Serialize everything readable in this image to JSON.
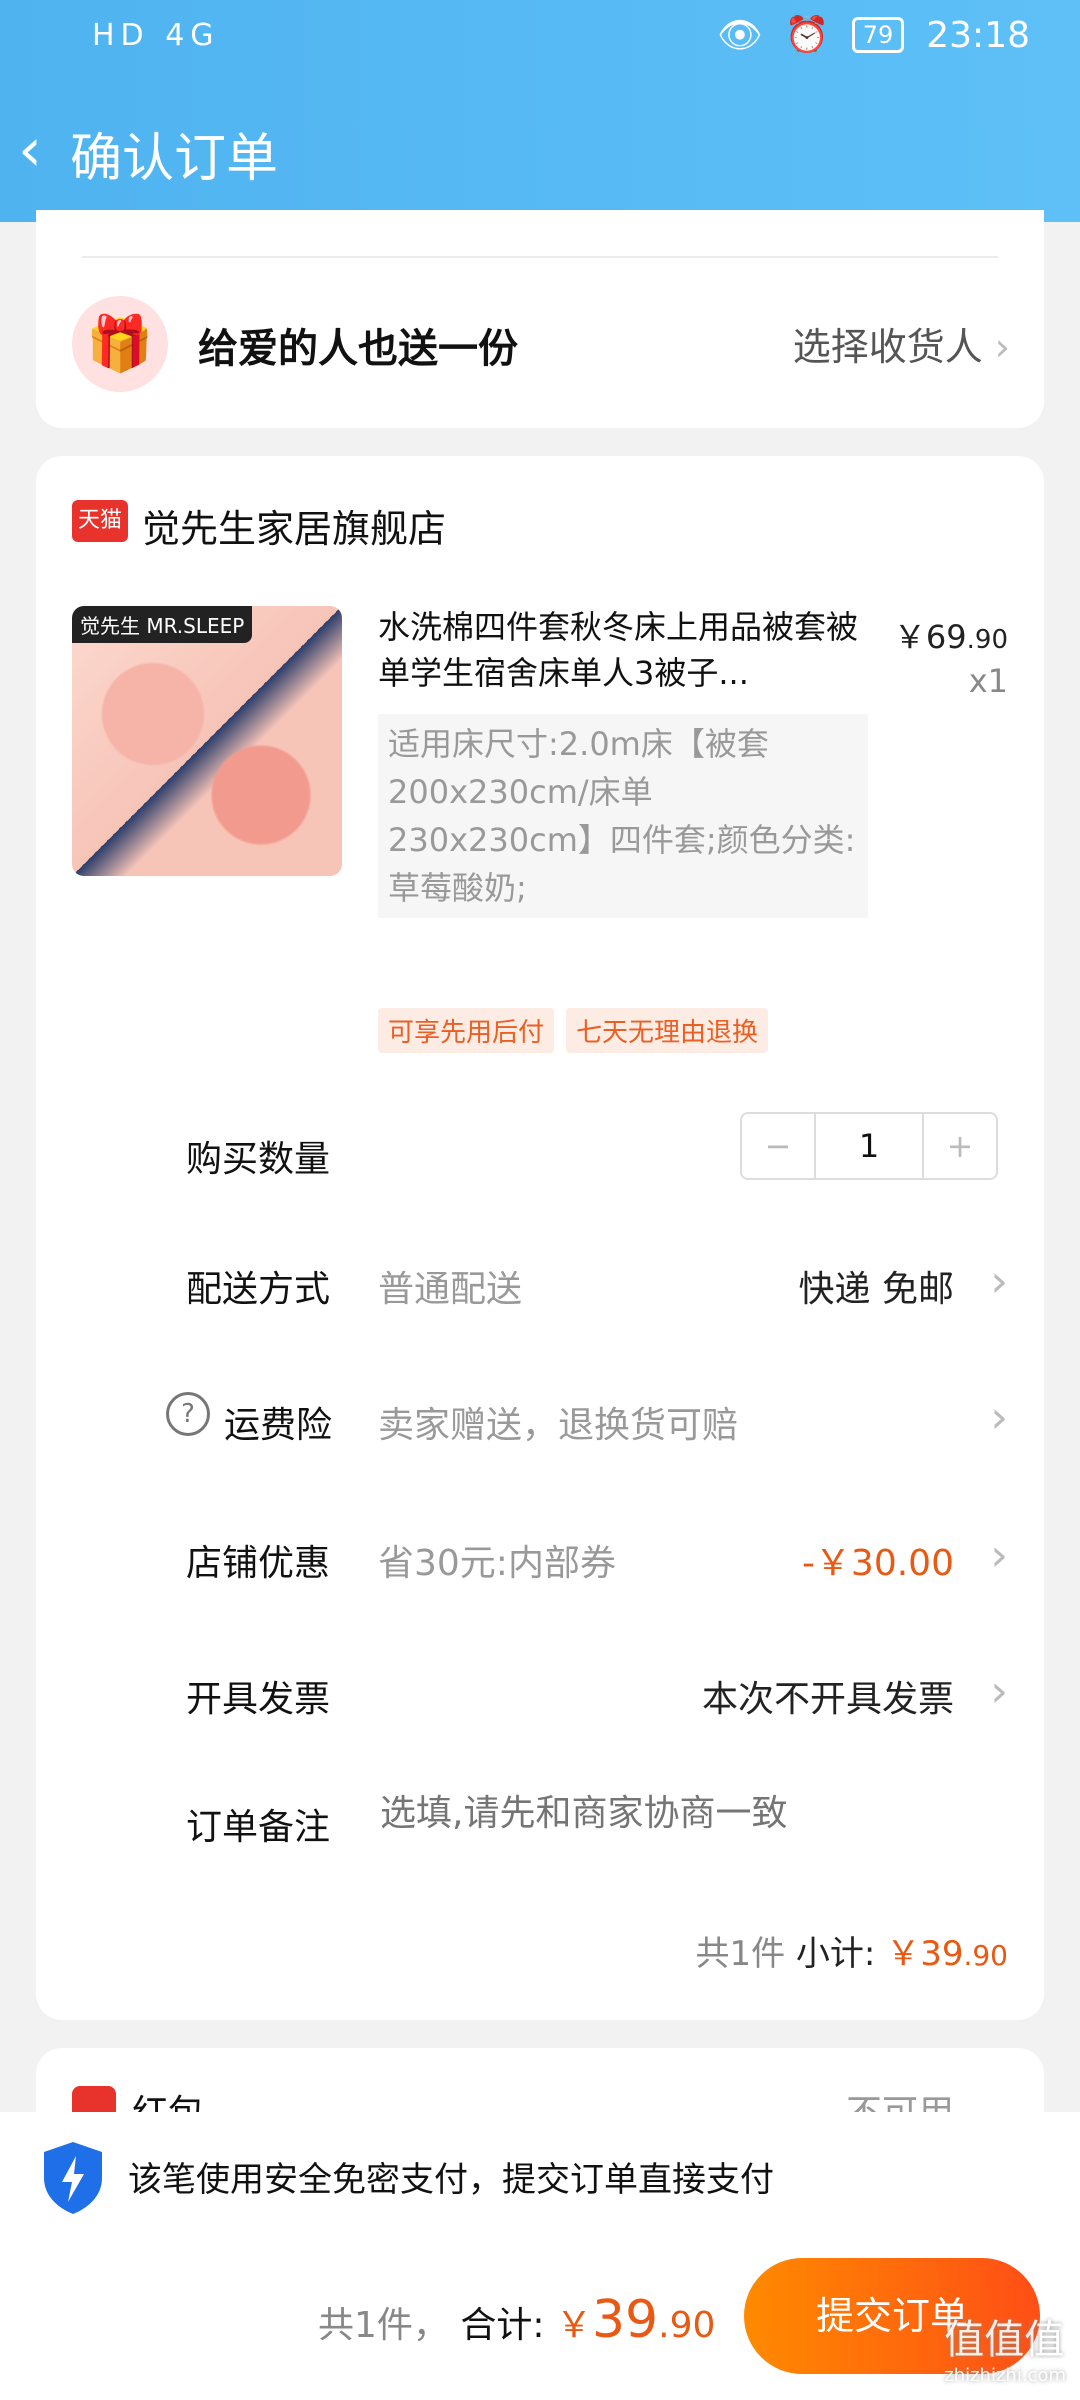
{
  "status": {
    "left": "HD 4G",
    "time": "23:18",
    "battery": "79"
  },
  "header": {
    "title": "确认订单"
  },
  "gift": {
    "label": "给爱的人也送一份",
    "link": "选择收货人"
  },
  "shop": {
    "badge": "天猫",
    "name": "觉先生家居旗舰店"
  },
  "product": {
    "image_brand": "觉先生 MR.SLEEP",
    "title": "水洗棉四件套秋冬床上用品被套被单学生宿舍床单人3被子...",
    "price_int": "￥69",
    "price_dec": ".90",
    "qty": "x1",
    "sku": "适用床尺寸:2.0m床【被套200x230cm/床单230x230cm】四件套;颜色分类:草莓酸奶;",
    "tags": [
      "可享先用后付",
      "七天无理由退换"
    ]
  },
  "rows": {
    "qty": {
      "label": "购买数量",
      "minus": "−",
      "value": "1",
      "plus": "+"
    },
    "delivery": {
      "label": "配送方式",
      "mid": "普通配送",
      "value": "快递 免邮"
    },
    "insurance": {
      "label": "运费险",
      "mid": "卖家赠送，退换货可赔"
    },
    "discount": {
      "label": "店铺优惠",
      "mid": "省30元:内部券",
      "value": "-￥30.00"
    },
    "invoice": {
      "label": "开具发票",
      "value": "本次不开具发票"
    },
    "note": {
      "label": "订单备注",
      "placeholder": "选填,请先和商家协商一致"
    }
  },
  "subtotal": {
    "count": "共1件",
    "label": "小计:",
    "amount": "￥39",
    "dec": ".90"
  },
  "redpacket": {
    "label": "红包",
    "value": "不可用"
  },
  "pay": {
    "note": "该笔使用安全免密支付，提交订单直接支付",
    "count": "共1件，",
    "total_label": "合计:",
    "yen": "￥",
    "total": "39",
    "dec": ".90",
    "submit": "提交订单"
  },
  "watermark": {
    "main": "值值值",
    "sub": "zhizhizhi.com"
  },
  "colors": {
    "accent": "#e85a14",
    "header": "#4fb3f0",
    "submit_start": "#ff8a00",
    "submit_end": "#ff4e16"
  }
}
